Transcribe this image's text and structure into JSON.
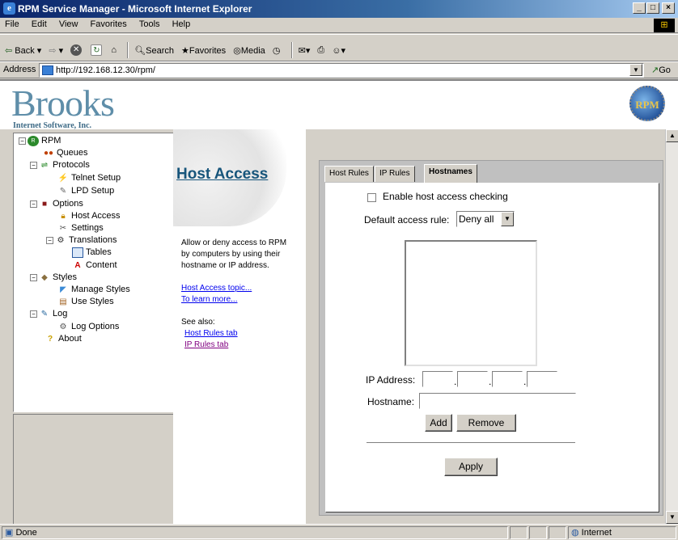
{
  "window": {
    "title": "RPM Service Manager - Microsoft Internet Explorer"
  },
  "menu": [
    "File",
    "Edit",
    "View",
    "Favorites",
    "Tools",
    "Help"
  ],
  "toolbar": {
    "back": "Back",
    "search": "Search",
    "favorites": "Favorites",
    "media": "Media"
  },
  "address": {
    "label": "Address",
    "url": "http://192.168.12.30/rpm/",
    "go": "Go"
  },
  "header": {
    "logo_text": "Brooks",
    "logo_sub": "Internet Software, Inc.",
    "seal_text": "RPM"
  },
  "tree": [
    {
      "label": "RPM"
    },
    {
      "label": "Queues"
    },
    {
      "label": "Protocols"
    },
    {
      "label": "Telnet Setup"
    },
    {
      "label": "LPD Setup"
    },
    {
      "label": "Options"
    },
    {
      "label": "Host Access"
    },
    {
      "label": "Settings"
    },
    {
      "label": "Translations"
    },
    {
      "label": "Tables"
    },
    {
      "label": "Content"
    },
    {
      "label": "Styles"
    },
    {
      "label": "Manage Styles"
    },
    {
      "label": "Use Styles"
    },
    {
      "label": "Log"
    },
    {
      "label": "Log Options"
    },
    {
      "label": "About"
    }
  ],
  "help": {
    "title": "Host Access",
    "description": "Allow or deny access to RPM by computers by using their hostname or IP address.",
    "topic_link_1": "Host Access topic...",
    "topic_link_2": "To learn more...",
    "see_also": "See also:",
    "see_also_links": [
      "Host Rules tab",
      "IP Rules tab"
    ]
  },
  "tabs": [
    {
      "label": "Host Rules"
    },
    {
      "label": "IP Rules"
    },
    {
      "label": "Hostnames"
    }
  ],
  "form": {
    "enable_label": "Enable host access checking",
    "enable_checked": false,
    "default_rule_label": "Default access rule:",
    "default_rule_value": "Deny all",
    "ip_label": "IP Address:",
    "ip_octets": [
      "",
      "",
      "",
      ""
    ],
    "hostname_label": "Hostname:",
    "hostname_value": "",
    "add_label": "Add",
    "remove_label": "Remove",
    "apply_label": "Apply"
  },
  "status": {
    "text": "Done",
    "zone": "Internet"
  },
  "colors": {
    "title_bar": "#0a246a",
    "help_title": "#17557b",
    "logo": "#5f8ea9"
  }
}
